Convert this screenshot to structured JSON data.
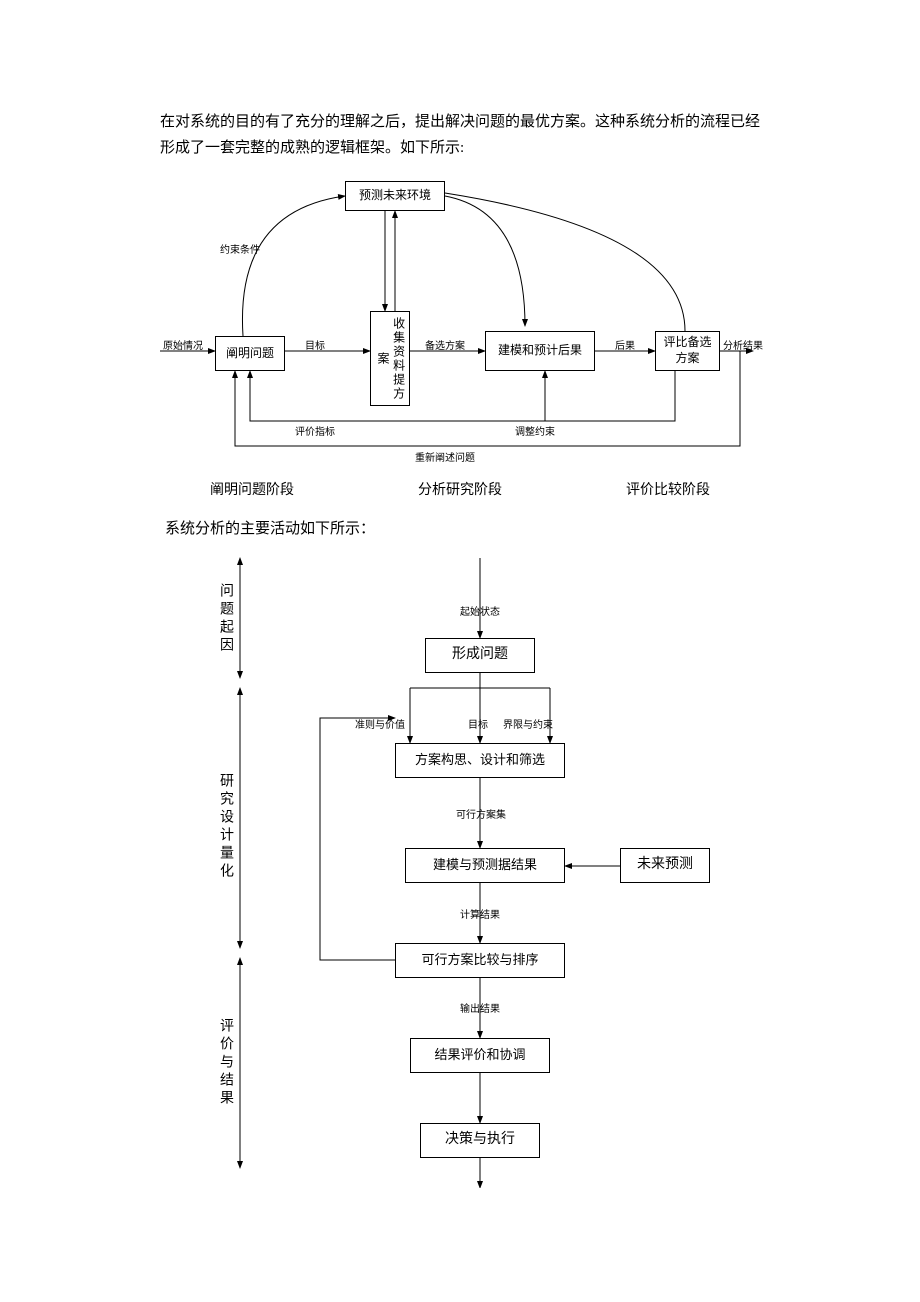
{
  "intro": "在对系统的目的有了充分的理解之后，提出解决问题的最优方案。这种系统分析的流程已经形成了一套完整的成熟的逻辑框架。如下所示:",
  "d1": {
    "boxes": {
      "predict": "预测未来环境",
      "clarify": "阐明问题",
      "collect": "收集资料提方案",
      "model": "建模和预计后果",
      "compare": "评比备选方案"
    },
    "labels": {
      "constraint": "约束条件",
      "orig": "原始情况",
      "goal": "目标",
      "alt": "备选方案",
      "result": "后果",
      "out": "分析结果",
      "metric": "评价指标",
      "adjust": "调整约束",
      "restate": "重新阐述问题"
    },
    "phases": {
      "p1": "阐明问题阶段",
      "p2": "分析研究阶段",
      "p3": "评价比较阶段"
    }
  },
  "sub_intro": "系统分析的主要活动如下所示：",
  "d2": {
    "sections": {
      "s1": "问题起因",
      "s2": "研究设计量化",
      "s3": "评价与结果"
    },
    "boxes": {
      "b1": "形成问题",
      "b2": "方案构思、设计和筛选",
      "b3": "建模与预测据结果",
      "b4": "未来预测",
      "b5": "可行方案比较与排序",
      "b6": "结果评价和协调",
      "b7": "决策与执行"
    },
    "labels": {
      "start": "起始状态",
      "l1": "准则与价值",
      "l2": "目标",
      "l3": "界限与约束",
      "l4": "可行方案集",
      "l5": "计算结果",
      "l6": "输出结果"
    }
  }
}
